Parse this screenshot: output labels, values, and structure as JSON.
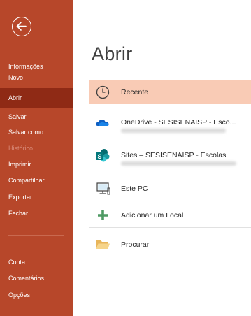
{
  "sidebar": {
    "back_icon": "back-arrow-icon",
    "items": [
      {
        "label": "Informações"
      },
      {
        "label": "Novo"
      },
      {
        "label": "Abrir"
      },
      {
        "label": "Salvar"
      },
      {
        "label": "Salvar como"
      },
      {
        "label": "Histórico"
      },
      {
        "label": "Imprimir"
      },
      {
        "label": "Compartilhar"
      },
      {
        "label": "Exportar"
      },
      {
        "label": "Fechar"
      },
      {
        "label": "Conta"
      },
      {
        "label": "Comentários"
      },
      {
        "label": "Opções"
      }
    ],
    "selected_item": "Abrir",
    "disabled_item": "Histórico",
    "background_color": "#b7472a",
    "selected_color": "#8f2a15"
  },
  "main": {
    "title": "Abrir",
    "locations": [
      {
        "label": "Recente",
        "icon": "clock-icon"
      },
      {
        "label": "OneDrive - SESISENAISP - Esco...",
        "icon": "onedrive-cloud-icon"
      },
      {
        "label": "Sites – SESISENAISP - Escolas",
        "icon": "sharepoint-icon"
      },
      {
        "label": "Este PC",
        "icon": "computer-icon"
      },
      {
        "label": "Adicionar um Local",
        "icon": "plus-icon"
      },
      {
        "label": "Procurar",
        "icon": "folder-icon"
      }
    ],
    "selected_location": "Recente",
    "selected_color": "#f9cbb5"
  }
}
